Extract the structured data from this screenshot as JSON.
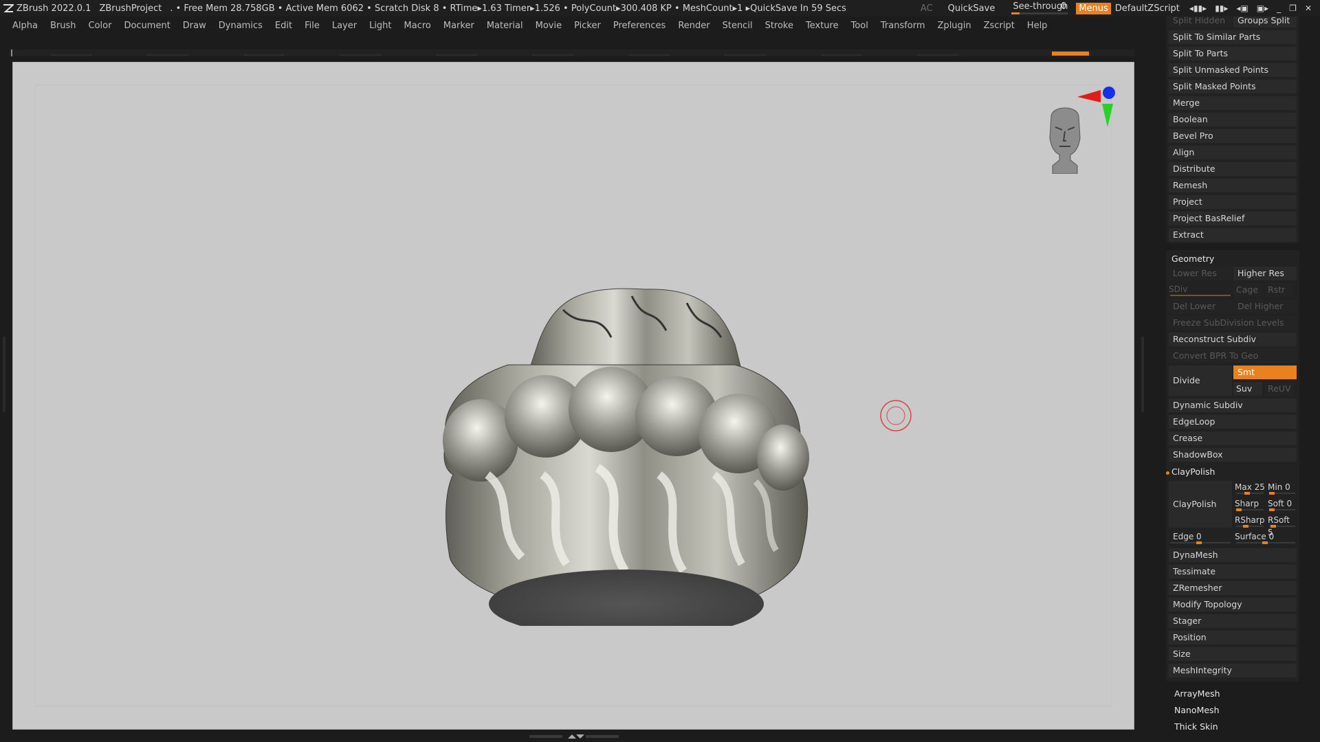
{
  "titlebar": {
    "app": "ZBrush 2022.0.1",
    "project": "ZBrushProject",
    "stats": ". • Free Mem 28.758GB • Active Mem 6062 • Scratch Disk 8 •  RTime▸1.63 Timer▸1.526 • PolyCount▸300.408 KP  • MeshCount▸1  ▸QuickSave In 59 Secs",
    "ac": "AC",
    "quicksave": "QuickSave",
    "seethrough_label": "See-through",
    "seethrough_value": "0",
    "menus": "Menus",
    "script": "DefaultZScript"
  },
  "menubar": [
    "Alpha",
    "Brush",
    "Color",
    "Document",
    "Draw",
    "Dynamics",
    "Edit",
    "File",
    "Layer",
    "Light",
    "Macro",
    "Marker",
    "Material",
    "Movie",
    "Picker",
    "Preferences",
    "Render",
    "Stencil",
    "Stroke",
    "Texture",
    "Tool",
    "Transform",
    "Zplugin",
    "Zscript",
    "Help"
  ],
  "subtool": {
    "split_hidden": "Split Hidden",
    "groups_split": "Groups Split",
    "items": [
      "Split To Similar Parts",
      "Split To Parts",
      "Split Unmasked Points",
      "Split Masked Points",
      "Merge",
      "Boolean",
      "Bevel Pro",
      "Align",
      "Distribute",
      "Remesh",
      "Project",
      "Project BasRelief",
      "Extract"
    ]
  },
  "geometry": {
    "title": "Geometry",
    "lower_res": "Lower Res",
    "higher_res": "Higher Res",
    "sdiv": "SDiv",
    "cage": "Cage",
    "rstr": "Rstr",
    "del_lower": "Del Lower",
    "del_higher": "Del Higher",
    "freeze": "Freeze SubDivision Levels",
    "reconstruct": "Reconstruct Subdiv",
    "convert_bpr": "Convert BPR To Geo",
    "divide": "Divide",
    "smt": "Smt",
    "suv": "Suv",
    "reuv": "ReUV",
    "dynamic_subdiv": "Dynamic Subdiv",
    "edgeloop": "EdgeLoop",
    "crease": "Crease",
    "shadowbox": "ShadowBox",
    "claypolish_header": "ClayPolish",
    "claypolish_btn": "ClayPolish",
    "max": "Max 25",
    "min": "Min 0",
    "sharp": "Sharp",
    "soft": "Soft 0",
    "rsharp": "RSharp",
    "rsoft": "RSoft 5",
    "edge": "Edge 0",
    "surface": "Surface 0",
    "more": [
      "DynaMesh",
      "Tessimate",
      "ZRemesher",
      "Modify Topology",
      "Stager",
      "Position",
      "Size",
      "MeshIntegrity"
    ]
  },
  "tool_sections": [
    "ArrayMesh",
    "NanoMesh",
    "Thick Skin"
  ]
}
